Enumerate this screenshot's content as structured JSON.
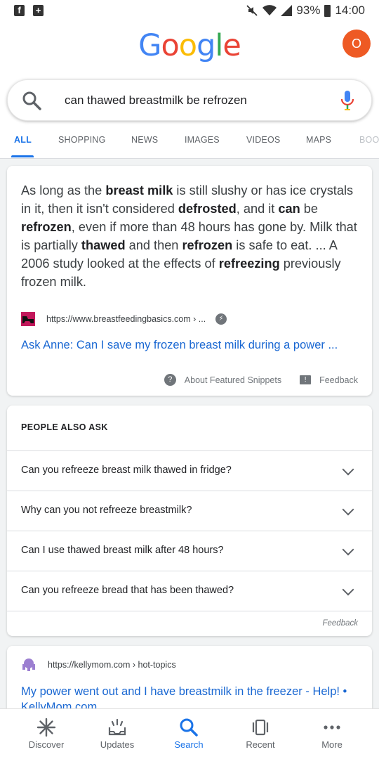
{
  "status_bar": {
    "battery": "93%",
    "time": "14:00"
  },
  "header": {
    "logo": [
      "G",
      "o",
      "o",
      "g",
      "l",
      "e"
    ],
    "logo_colors": [
      "#4285f4",
      "#ea4335",
      "#fbbc05",
      "#4285f4",
      "#34a853",
      "#ea4335"
    ],
    "avatar_initial": "O",
    "avatar_color": "#ee5a24"
  },
  "search": {
    "query": "can thawed breastmilk be refrozen"
  },
  "tabs": [
    "ALL",
    "SHOPPING",
    "NEWS",
    "IMAGES",
    "VIDEOS",
    "MAPS",
    "BOO"
  ],
  "featured_snippet": {
    "url": "https://www.breastfeedingbasics.com › ...",
    "link_title": "Ask Anne: Can I save my frozen breast milk during a power ...",
    "about_label": "About Featured Snippets",
    "feedback_label": "Feedback",
    "segments": [
      {
        "t": "As long as the ",
        "b": false
      },
      {
        "t": "breast milk",
        "b": true
      },
      {
        "t": " is still slushy or has ice crystals in it, then it isn't considered ",
        "b": false
      },
      {
        "t": "defrosted",
        "b": true
      },
      {
        "t": ", and it ",
        "b": false
      },
      {
        "t": "can",
        "b": true
      },
      {
        "t": " be ",
        "b": false
      },
      {
        "t": "refrozen",
        "b": true
      },
      {
        "t": ", even if more than 48 hours has gone by. Milk that is partially ",
        "b": false
      },
      {
        "t": "thawed",
        "b": true
      },
      {
        "t": " and then ",
        "b": false
      },
      {
        "t": "refrozen",
        "b": true
      },
      {
        "t": " is safe to eat. ... A 2006 study looked at the effects of ",
        "b": false
      },
      {
        "t": "refreezing",
        "b": true
      },
      {
        "t": " previously frozen milk.",
        "b": false
      }
    ]
  },
  "people_also_ask": {
    "title": "PEOPLE ALSO ASK",
    "questions": [
      "Can you refreeze breast milk thawed in fridge?",
      "Why can you not refreeze breastmilk?",
      "Can I use thawed breast milk after 48 hours?",
      "Can you refreeze bread that has been thawed?"
    ],
    "feedback_label": "Feedback"
  },
  "result2": {
    "url": "https://kellymom.com › hot-topics",
    "title": "My power went out and I have breastmilk in the freezer - Help! • KellyMom.com"
  },
  "bottom_nav": {
    "items": [
      {
        "label": "Discover",
        "icon": "asterisk-icon"
      },
      {
        "label": "Updates",
        "icon": "updates-tray-icon"
      },
      {
        "label": "Search",
        "icon": "search-icon"
      },
      {
        "label": "Recent",
        "icon": "recent-cards-icon"
      },
      {
        "label": "More",
        "icon": "more-dots-icon"
      }
    ],
    "active_color": "#1a73e8"
  }
}
